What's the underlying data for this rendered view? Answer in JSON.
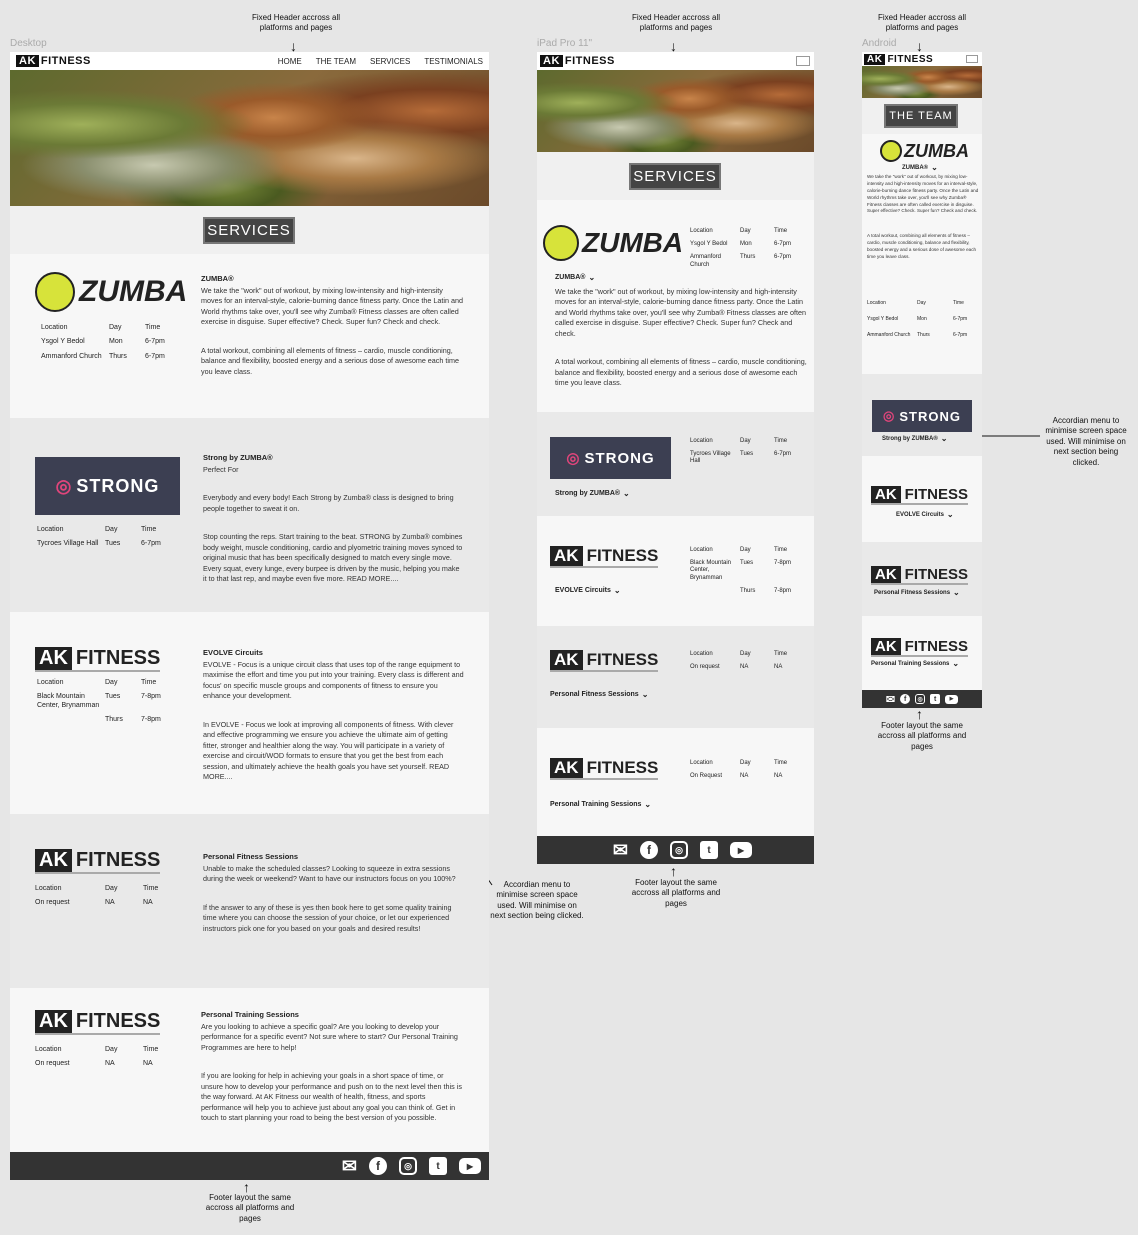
{
  "annotations": {
    "fixed_header": "Fixed Header accross all platforms and pages",
    "footer": "Footer layout the same accross all platforms and pages",
    "accordion": "Accordian menu to minimise screen space used. Will minimise on next section being clicked."
  },
  "frames": {
    "desktop": "Desktop",
    "ipad": "iPad Pro 11\"",
    "android": "Android"
  },
  "header": {
    "logo_ak": "AK",
    "logo_fitness": "FITNESS",
    "nav": [
      "HOME",
      "THE TEAM",
      "SERVICES",
      "TESTIMONIALS"
    ]
  },
  "page_title": "SERVICES",
  "android_title": "THE TEAM",
  "table_headers": {
    "location": "Location",
    "day": "Day",
    "time": "Time"
  },
  "brands": {
    "zumba": "ZUMBA",
    "strong": "STRONG",
    "strong_sub": "BY ZUMBA",
    "ak": "AK",
    "fitness": "FITNESS"
  },
  "services": {
    "zumba": {
      "title": "ZUMBA®",
      "rows": [
        [
          "Ysgol Y Bedol",
          "Mon",
          "6-7pm"
        ],
        [
          "Ammanford Church",
          "Thurs",
          "6-7pm"
        ]
      ],
      "p1": "We take the \"work\" out of workout, by mixing low-intensity and high-intensity moves for an interval-style, calorie-burning dance fitness party. Once the Latin and World rhythms take over, you'll see why Zumba® Fitness classes are often called exercise in disguise. Super effective? Check. Super fun? Check and check.",
      "p2": "A total workout, combining all elements of fitness – cardio, muscle conditioning, balance and flexibility, boosted energy and a serious dose of awesome each time you leave class."
    },
    "strong": {
      "title": "Strong by ZUMBA®",
      "sub": "Perfect For",
      "rows": [
        [
          "Tycroes Village Hall",
          "Tues",
          "6-7pm"
        ]
      ],
      "p1": "Everybody and every body! Each Strong by Zumba® class is designed to bring people together to sweat it on.",
      "p2": "Stop counting the reps. Start training to the beat. STRONG by Zumba® combines body weight, muscle conditioning, cardio and plyometric training moves synced to original music that has been specifically designed to match every single move. Every squat, every lunge, every burpee is driven by the music, helping you make it to that last rep, and maybe even five more.  READ MORE...."
    },
    "evolve": {
      "title": "EVOLVE Circuits",
      "rows": [
        [
          "Black Mountain Center, Brynamman",
          "Tues",
          "7-8pm"
        ],
        [
          "",
          "Thurs",
          "7-8pm"
        ]
      ],
      "p1": "EVOLVE - Focus is a unique circuit class that uses top of the range equipment to maximise the effort and time you put into your training. Every class is different and focus' on specific muscle groups and components of fitness to ensure you enhance your development.",
      "p2": "In EVOLVE - Focus we look at improving all components of fitness. With clever and effective programming we ensure you achieve the ultimate aim of getting fitter, stronger and healthier along the way. You will participate in a variety of exercise and circuit/WOD formats to ensure that you get the best from each session, and ultimately achieve the health goals you have set yourself.  READ MORE...."
    },
    "pfs": {
      "title": "Personal Fitness Sessions",
      "rows": [
        [
          "On request",
          "NA",
          "NA"
        ]
      ],
      "p1": "Unable to make the scheduled classes? Looking to squeeze in extra sessions during the week or weekend? Want to have our instructors focus on you 100%?",
      "p2": "If the answer to any of these is yes then book here to get some quality training time where you can choose the session of your choice, or let our experienced instructors pick one for you based on your goals and desired results!"
    },
    "pts": {
      "title": "Personal Training Sessions",
      "rows": [
        [
          "On request",
          "NA",
          "NA"
        ]
      ],
      "ipad_location": "On Request",
      "p1": "Are you looking to achieve a specific goal? Are you looking to develop your performance for a specific event? Not sure where to start? Our Personal Training Programmes are here to help!",
      "p2": "If you are looking for help in achieving your goals in a short space of time, or unsure how to develop your performance and push on to the next level then this is the way forward. At AK Fitness our wealth of health, fitness, and sports performance will help you to achieve just about any goal you can think of. Get in touch to start planning your road to being the best version of you possible."
    }
  },
  "android": {
    "p1": "We take the \"work\" out of workout, by mixing low-intensity and high-intensity moves for an interval-style, calorie-burning dance fitness party. Once the Latin and World rhythms take over, you'll see why Zumba® Fitness classes are often called exercise in disguise. Super effective? Check. Super fun? Check and check.",
    "p2": "A total workout, combining all elements of fitness – cardio, muscle conditioning, balance and flexibility, boosted energy and a serious dose of awesome each time you leave class."
  },
  "footer_icons": [
    "mail-icon",
    "facebook-icon",
    "instagram-icon",
    "twitter-icon",
    "youtube-icon"
  ],
  "colors": {
    "footer": "#333333",
    "title_bg": "#444444",
    "zumba_green": "#d7e33a",
    "strong_bg": "#3c3f52"
  }
}
